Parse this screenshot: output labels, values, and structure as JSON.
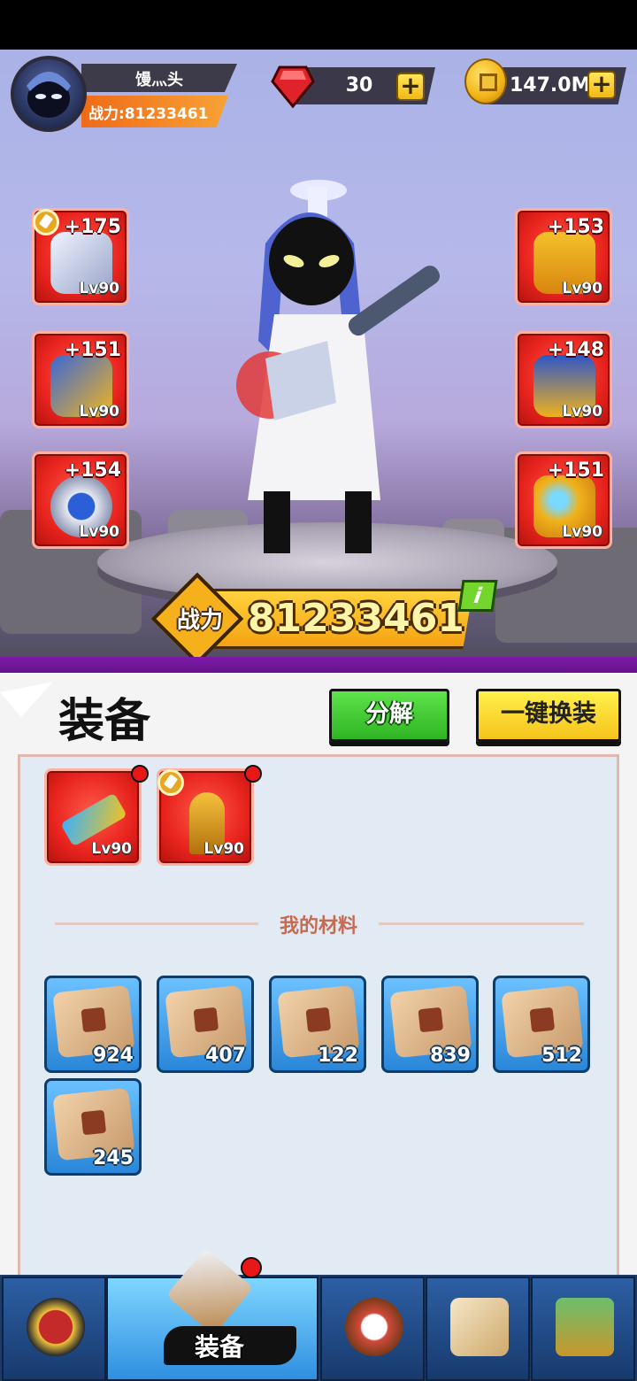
{
  "player": {
    "name": "馒灬头",
    "power_label": "战力:81233461"
  },
  "currency": {
    "gems": "30",
    "coins": "147.0M",
    "plus": "+"
  },
  "equipped_left": [
    {
      "enhance": "+175",
      "level": "Lv90",
      "icon": "gauntlet-icon",
      "locked": true
    },
    {
      "enhance": "+151",
      "level": "Lv90",
      "icon": "boots-icon",
      "locked": false
    },
    {
      "enhance": "+154",
      "level": "Lv90",
      "icon": "ring-icon",
      "locked": false
    }
  ],
  "equipped_right": [
    {
      "enhance": "+153",
      "level": "Lv90",
      "icon": "helmet-icon"
    },
    {
      "enhance": "+148",
      "level": "Lv90",
      "icon": "armor-icon"
    },
    {
      "enhance": "+151",
      "level": "Lv90",
      "icon": "necklace-icon"
    }
  ],
  "combat_power": {
    "label": "战力",
    "value": "81233461",
    "info": "i"
  },
  "panel": {
    "title": "装备",
    "decompose_button": "分解",
    "auto_equip_button": "一键换装"
  },
  "inventory_items": [
    {
      "level": "Lv90",
      "icon": "sword-icon",
      "locked": false
    },
    {
      "level": "Lv90",
      "icon": "spear-icon",
      "locked": true
    }
  ],
  "materials": {
    "title": "我的材料",
    "items": [
      {
        "icon": "weapon-scroll-icon",
        "qty": "924"
      },
      {
        "icon": "armor-scroll-icon",
        "qty": "407"
      },
      {
        "icon": "ring-scroll-icon",
        "qty": "122"
      },
      {
        "icon": "boots-scroll-icon",
        "qty": "839"
      },
      {
        "icon": "gauntlet-scroll-icon",
        "qty": "512"
      },
      {
        "icon": "helmet-scroll-icon",
        "qty": "245"
      }
    ]
  },
  "nav": {
    "active_label": "装备",
    "tabs": [
      "hero-tab-icon",
      "equipment-tab-icon",
      "drum-tab-icon",
      "scroll-tab-icon",
      "shop-tab-icon"
    ]
  },
  "colors": {
    "slot_red": "#e8231d",
    "material_blue": "#2a86d8",
    "green_button": "#2fb524",
    "yellow_button": "#f6c31b"
  }
}
